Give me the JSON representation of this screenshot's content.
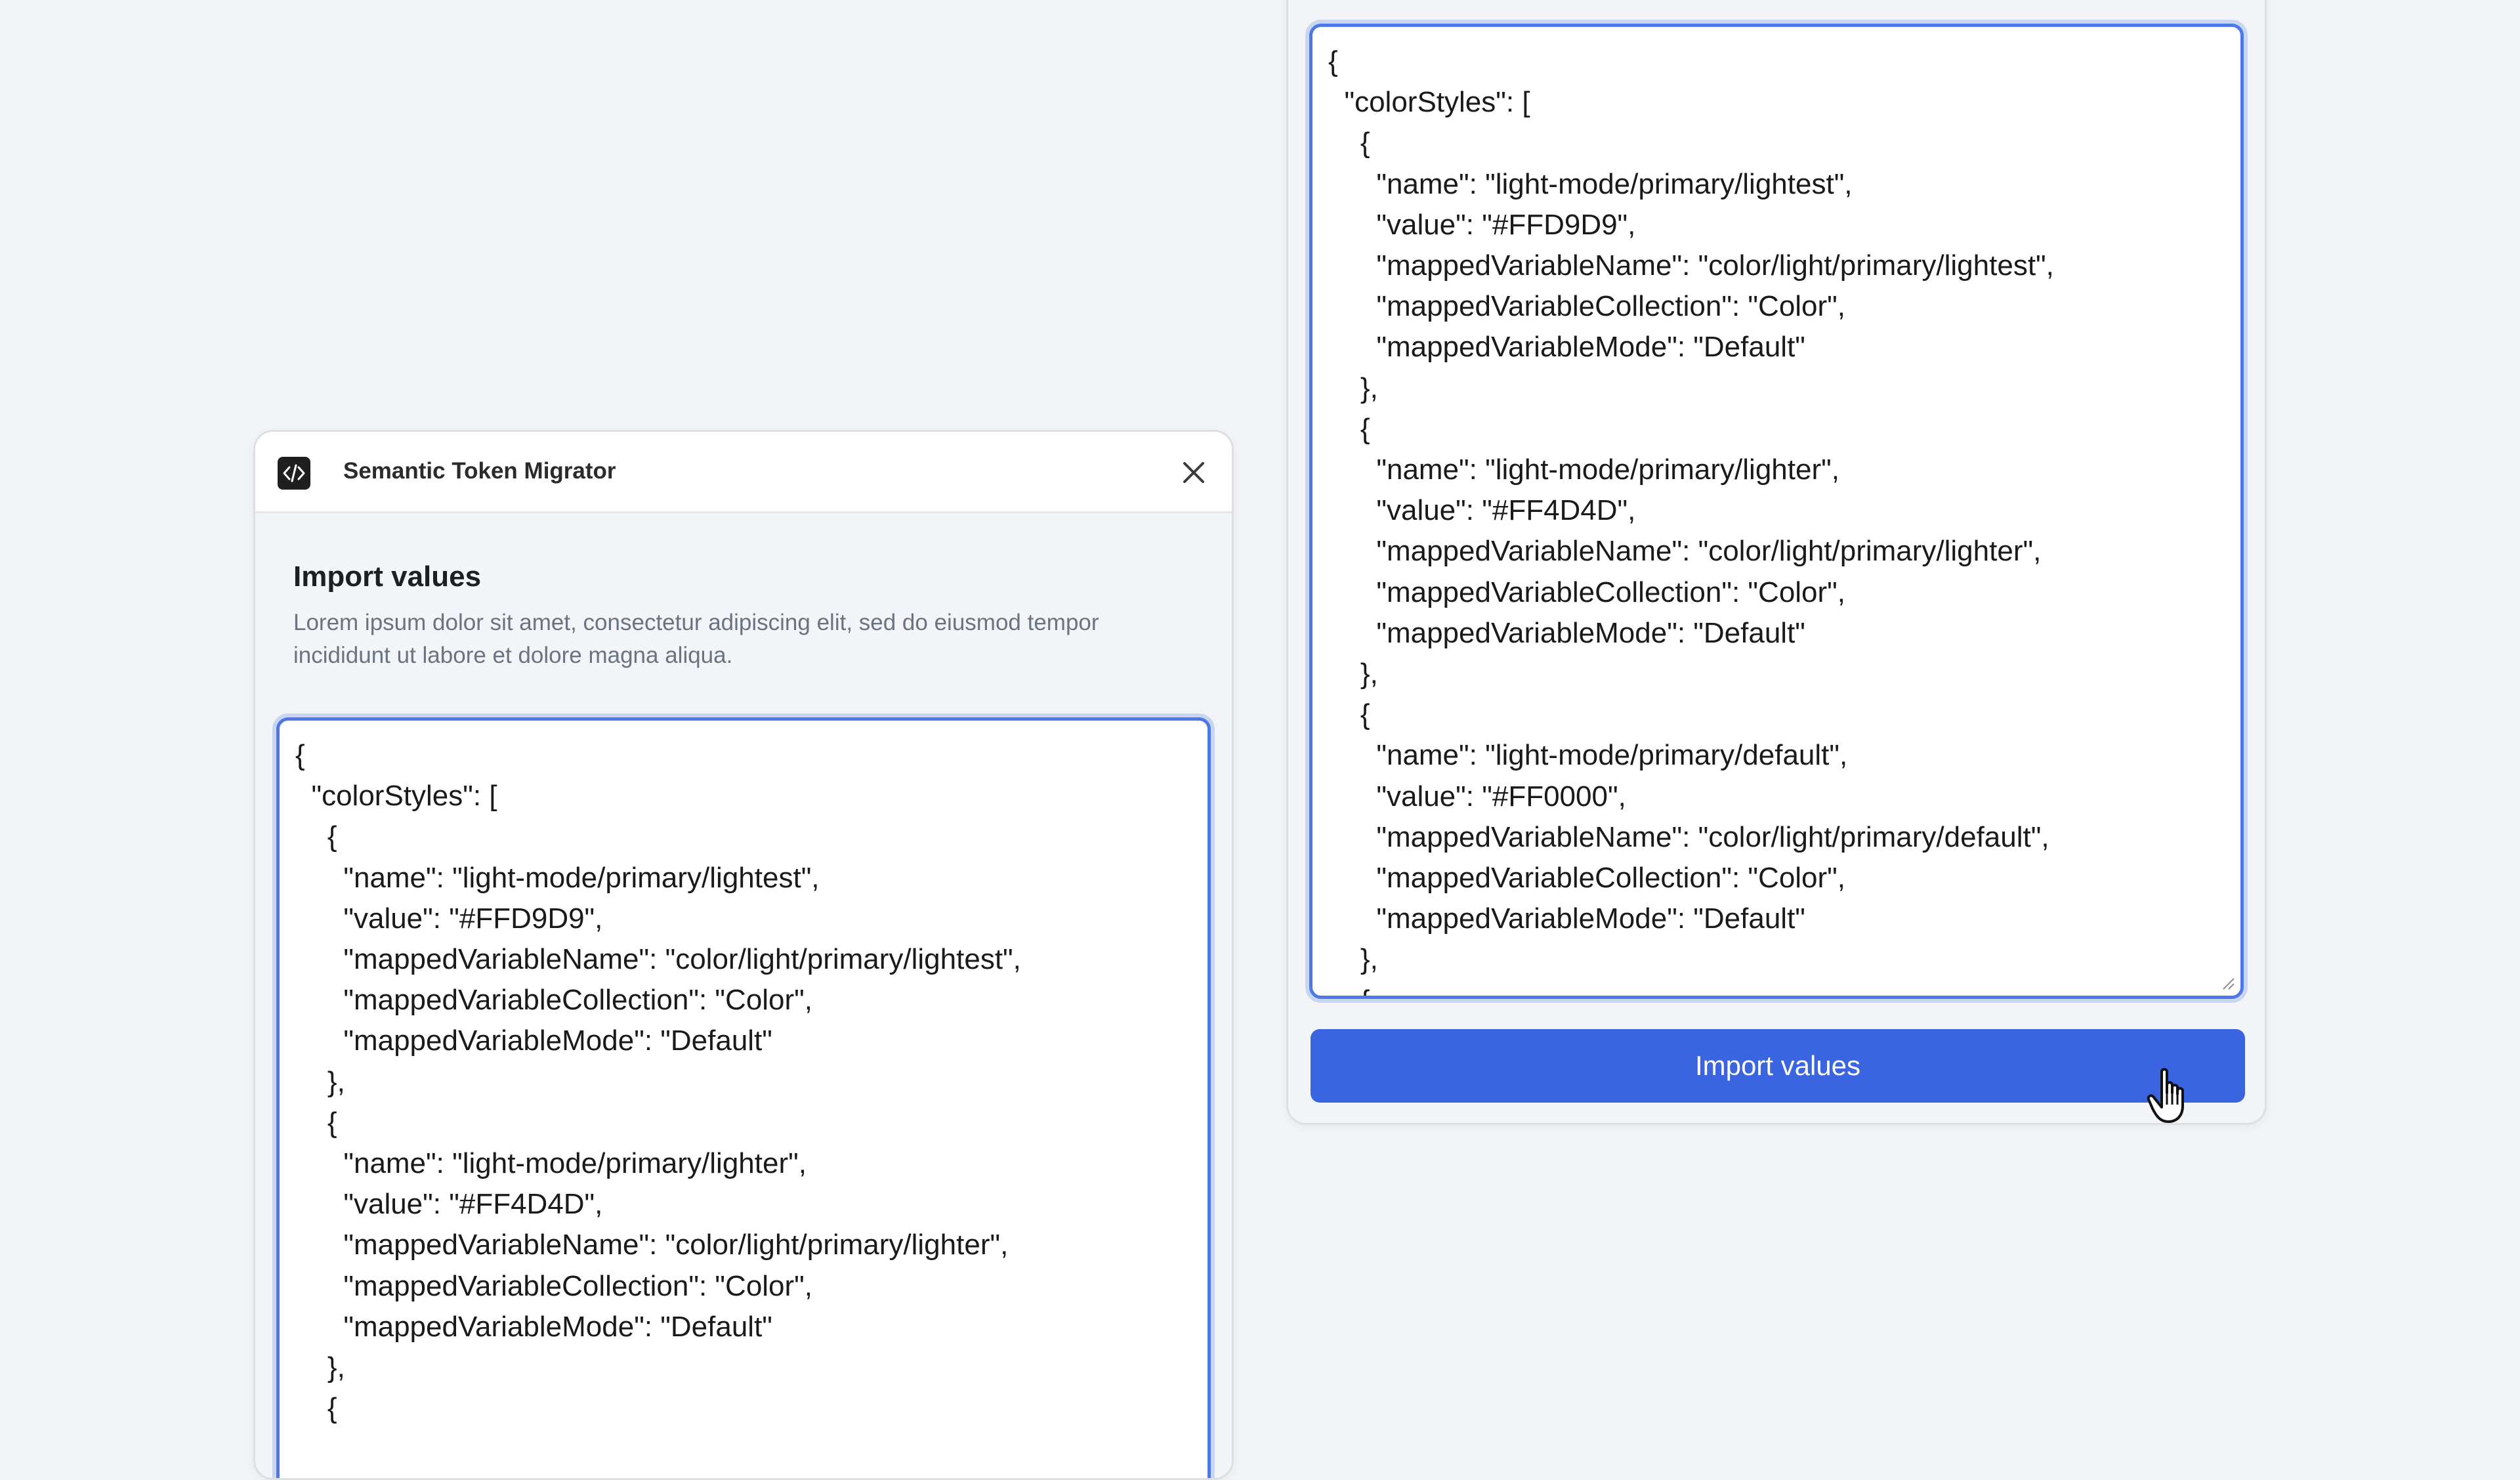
{
  "window": {
    "title": "Semantic Token Migrator",
    "icon": "code-icon",
    "close_icon": "close-icon"
  },
  "import_section": {
    "heading": "Import values",
    "description": "Lorem ipsum dolor sit amet, consectetur adipiscing elit, sed do eiusmod tempor incididunt ut labore et dolore magna aliqua."
  },
  "left_textarea": {
    "value": "{\n  \"colorStyles\": [\n    {\n      \"name\": \"light-mode/primary/lightest\",\n      \"value\": \"#FFD9D9\",\n      \"mappedVariableName\": \"color/light/primary/lightest\",\n      \"mappedVariableCollection\": \"Color\",\n      \"mappedVariableMode\": \"Default\"\n    },\n    {\n      \"name\": \"light-mode/primary/lighter\",\n      \"value\": \"#FF4D4D\",\n      \"mappedVariableName\": \"color/light/primary/lighter\",\n      \"mappedVariableCollection\": \"Color\",\n      \"mappedVariableMode\": \"Default\"\n    },\n    {"
  },
  "right_textarea": {
    "value": "{\n  \"colorStyles\": [\n    {\n      \"name\": \"light-mode/primary/lightest\",\n      \"value\": \"#FFD9D9\",\n      \"mappedVariableName\": \"color/light/primary/lightest\",\n      \"mappedVariableCollection\": \"Color\",\n      \"mappedVariableMode\": \"Default\"\n    },\n    {\n      \"name\": \"light-mode/primary/lighter\",\n      \"value\": \"#FF4D4D\",\n      \"mappedVariableName\": \"color/light/primary/lighter\",\n      \"mappedVariableCollection\": \"Color\",\n      \"mappedVariableMode\": \"Default\"\n    },\n    {\n      \"name\": \"light-mode/primary/default\",\n      \"value\": \"#FF0000\",\n      \"mappedVariableName\": \"color/light/primary/default\",\n      \"mappedVariableCollection\": \"Color\",\n      \"mappedVariableMode\": \"Default\"\n    },\n    {"
  },
  "import_button": {
    "label": "Import values"
  },
  "colors": {
    "background": "#f2f4f7",
    "accent": "#3a64e0",
    "focus_ring": "#4d78e6"
  }
}
